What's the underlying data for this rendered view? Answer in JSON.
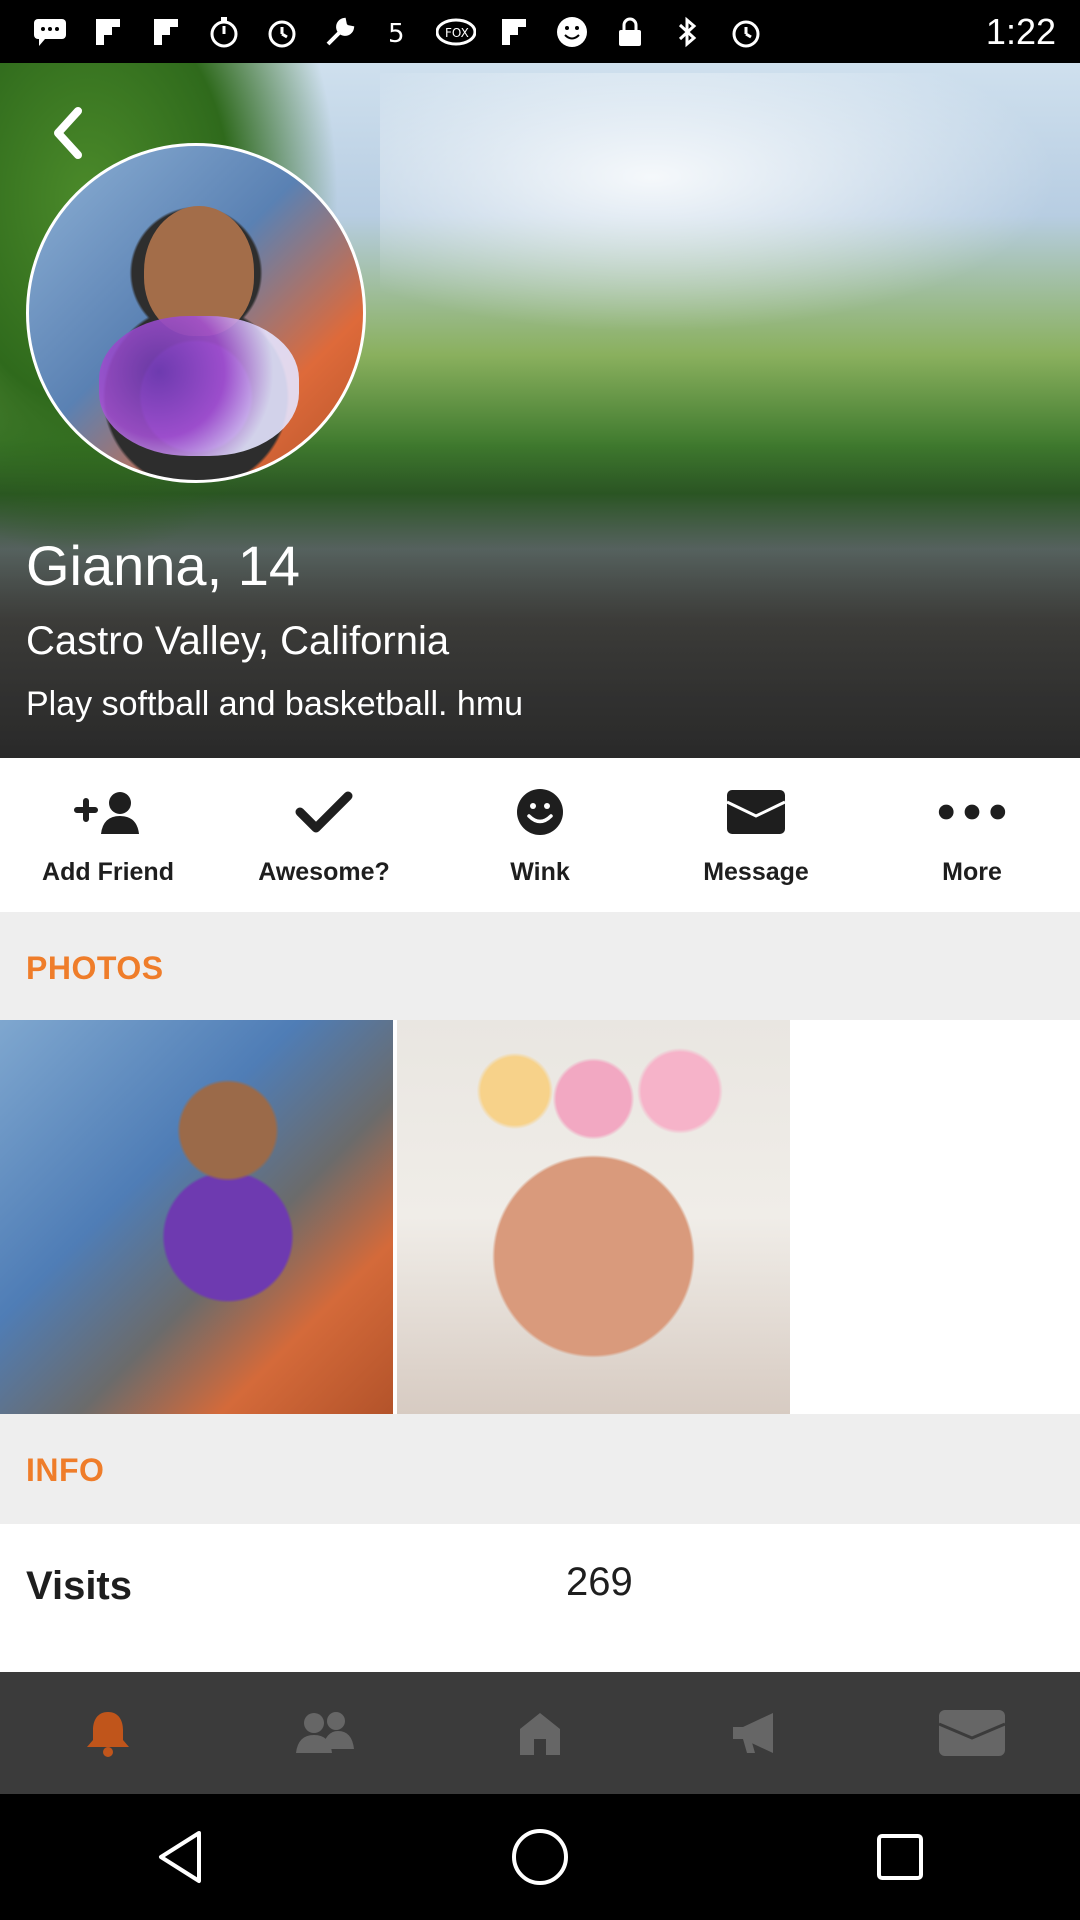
{
  "status_bar": {
    "time": "1:22",
    "icons": [
      "chat-icon",
      "flipboard-icon",
      "flipboard-icon",
      "timer-icon",
      "alarm-icon",
      "wrench-icon",
      "game-icon",
      "fox-sports-icon",
      "flipboard-icon",
      "smiley-icon",
      "lock-icon",
      "bluetooth-icon",
      "alarm-icon"
    ]
  },
  "profile": {
    "name": "Gianna, 14",
    "location": "Castro Valley, California",
    "bio": "Play softball and basketball. hmu"
  },
  "actions": [
    {
      "label": "Add Friend",
      "icon": "add-friend-icon"
    },
    {
      "label": "Awesome?",
      "icon": "checkmark-icon"
    },
    {
      "label": "Wink",
      "icon": "smiley-icon"
    },
    {
      "label": "Message",
      "icon": "envelope-icon"
    },
    {
      "label": "More",
      "icon": "more-dots-icon"
    }
  ],
  "sections": {
    "photos_title": "PHOTOS",
    "info_title": "INFO"
  },
  "info": {
    "visits_label": "Visits",
    "visits_value": "269"
  },
  "tabbar": [
    "bell-icon",
    "friends-icon",
    "home-icon",
    "megaphone-icon",
    "inbox-icon"
  ],
  "colors": {
    "accent": "#ef7d2a",
    "tabbar_bg": "#3b3b3b",
    "section_bg": "#eeeeee"
  }
}
